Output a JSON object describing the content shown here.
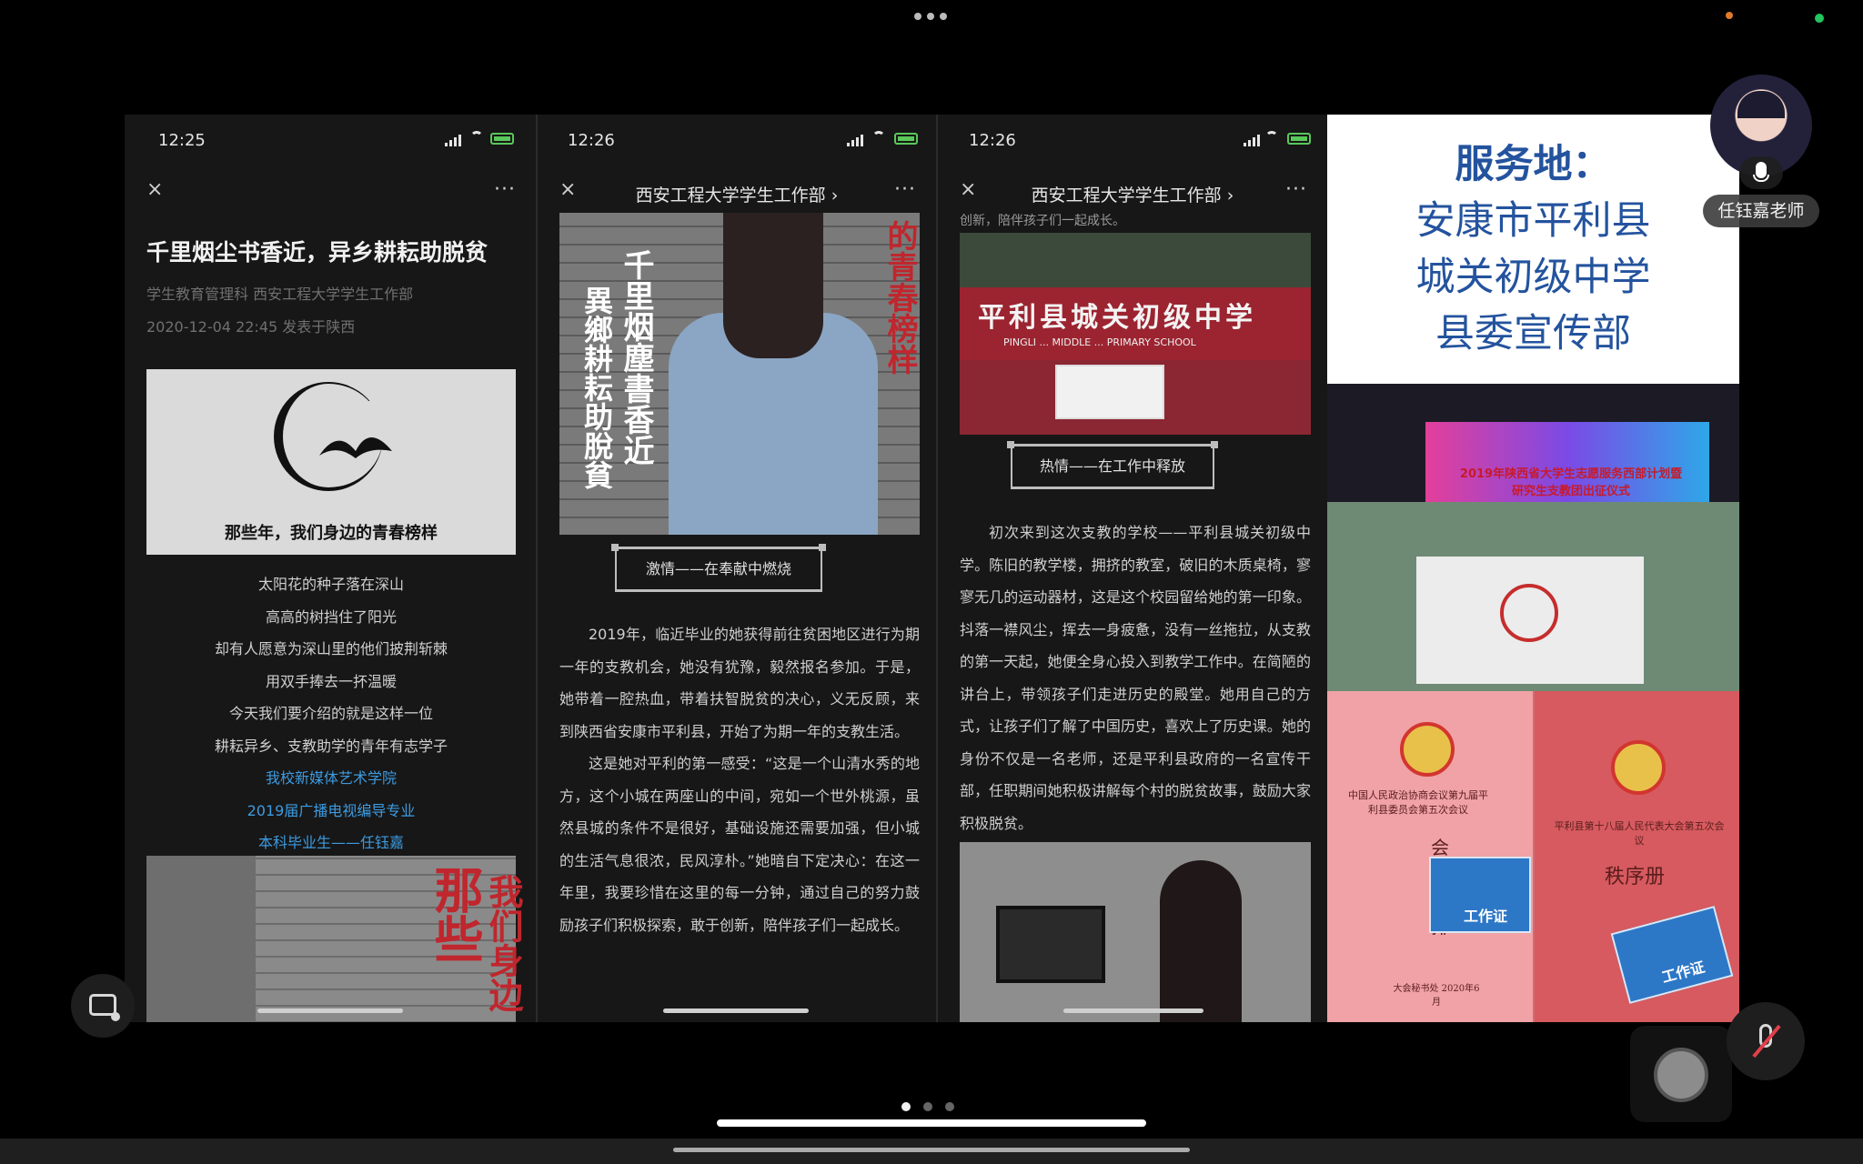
{
  "colors": {
    "accent_blue": "#24539e",
    "link_blue": "#3d9be0",
    "mute_red": "#e0404a",
    "presence_green": "#22c55e"
  },
  "phones": [
    {
      "time": "12:25",
      "nav_title": "",
      "close_icon": "×",
      "more_icon": "···"
    },
    {
      "time": "12:26",
      "nav_title": "西安工程大学学生工作部 ›",
      "close_icon": "×",
      "more_icon": "···"
    },
    {
      "time": "12:26",
      "nav_title": "西安工程大学学生工作部 ›",
      "close_icon": "×",
      "more_icon": "···"
    }
  ],
  "article1": {
    "title": "千里烟尘书香近，异乡耕耘助脱贫",
    "source": "学生教育管理科   西安工程大学学生工作部",
    "date": "2020-12-04 22:45   发表于陕西",
    "logo_caption": "那些年，我们身边的青春榜样",
    "poem": [
      "太阳花的种子落在深山",
      "高高的树挡住了阳光",
      "却有人愿意为深山里的他们披荆斩棘",
      "用双手捧去一抔温暖",
      "今天我们要介绍的就是这样一位",
      "耕耘异乡、支教助学的青年有志学子"
    ],
    "links": [
      "我校新媒体艺术学院",
      "2019届广播电视编导专业",
      "本科毕业生——任钰嘉"
    ],
    "photo_text_a": "那些",
    "photo_text_b": "我们身边"
  },
  "article2": {
    "poster_v1": "千里烟塵書香近",
    "poster_v2": "異鄉耕耘助脫貧",
    "poster_red": "的青春榜样",
    "caption": "激情——在奉献中燃烧",
    "paragraphs": [
      "2019年，临近毕业的她获得前往贫困地区进行为期一年的支教机会，她没有犹豫，毅然报名参加。于是，她带着一腔热血，带着扶智脱贫的决心，义无反顾，来到陕西省安康市平利县，开始了为期一年的支教生活。",
      "这是她对平利的第一感受：“这是一个山清水秀的地方，这个小城在两座山的中间，宛如一个世外桃源，虽然县城的条件不是很好，基础设施还需要加强，但小城的生活气息很浓，民风淳朴。”她暗自下定决心：在这一年里，我要珍惜在这里的每一分钟，通过自己的努力鼓励孩子们积极探索，敢于创新，陪伴孩子们一起成长。"
    ]
  },
  "article3": {
    "top_fragment": "创新，陪伴孩子们一起成长。",
    "sign_text": "平利县城关初级中学",
    "sign_sub": "PINGLI ... MIDDLE ... PRIMARY SCHOOL",
    "caption": "热情——在工作中释放",
    "paragraph": "初次来到这次支教的学校——平利县城关初级中学。陈旧的教学楼，拥挤的教室，破旧的木质桌椅，寥寥无几的运动器材，这是这个校园留给她的第一印象。抖落一襟风尘，挥去一身疲惫，没有一丝拖拉，从支教的第一天起，她便全身心投入到教学工作中。在简陋的讲台上，带领孩子们走进历史的殿堂。她用自己的方式，让孩子们了解了中国历史，喜欢上了历史课。她的身份不仅是一名老师，还是平利县政府的一名宣传干部，任职期间她积极讲解每个村的脱贫故事，鼓励大家积极脱贫。"
  },
  "slide": {
    "lines": [
      "服务地：",
      "安康市平利县",
      "城关初级中学",
      "县委宣传部"
    ],
    "stage_text_1": "2019年陕西省大学生志愿服务西部计划暨",
    "stage_text_2": "研究生支教团出征仪式",
    "book1_text": "中国人民政治协商会议第九届平利县委员会第五次会议",
    "book1_title": "会务安排",
    "book1_footer": "大会秘书处 2020年6月",
    "card1": "工作证",
    "book2_text": "平利县第十八届人民代表大会第五次会议",
    "book2_title": "秩序册",
    "card2": "工作证"
  },
  "participant": {
    "name": "任钰嘉老师"
  },
  "pager": {
    "count": 3,
    "active": 0
  }
}
